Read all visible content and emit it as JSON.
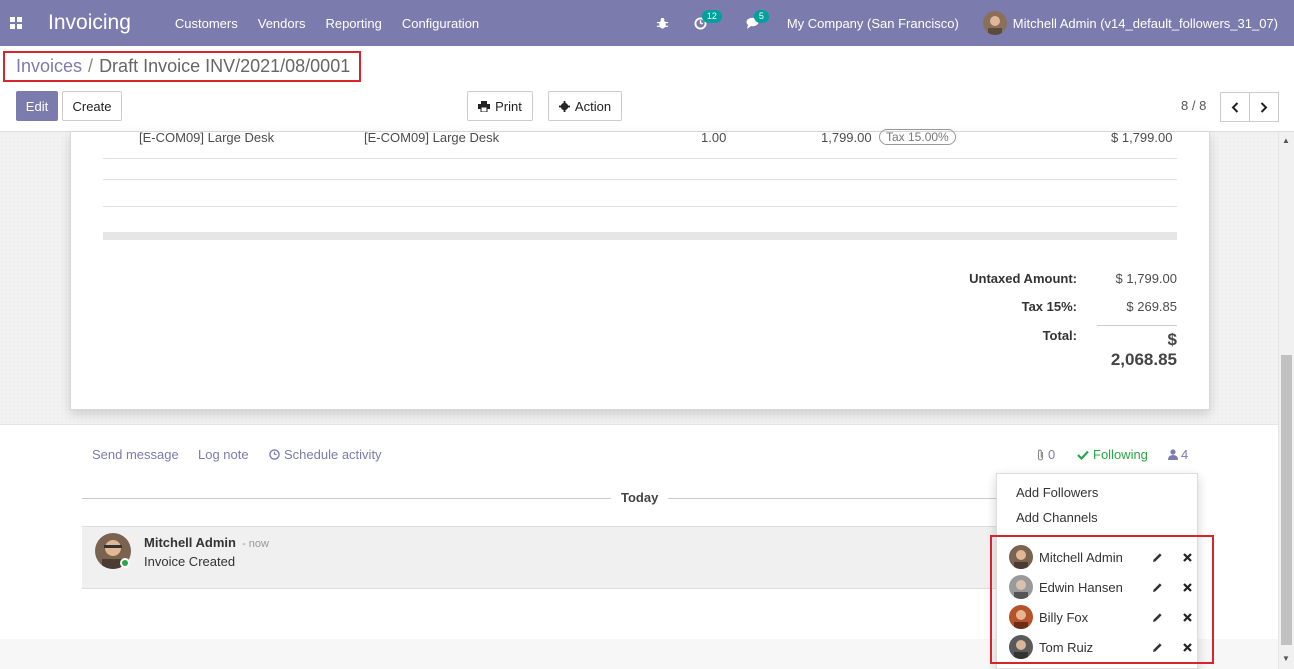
{
  "navbar": {
    "app_title": "Invoicing",
    "menu": [
      "Customers",
      "Vendors",
      "Reporting",
      "Configuration"
    ],
    "activity_count": "12",
    "message_count": "5",
    "company": "My Company (San Francisco)",
    "user": "Mitchell Admin (v14_default_followers_31_07)"
  },
  "breadcrumb": {
    "parent": "Invoices",
    "separator": "/",
    "current": "Draft Invoice INV/2021/08/0001"
  },
  "toolbar": {
    "edit_label": "Edit",
    "create_label": "Create",
    "print_label": "Print",
    "action_label": "Action"
  },
  "pager": {
    "value": "8 / 8"
  },
  "invoice_line": {
    "product": "[E-COM09] Large Desk",
    "label": "[E-COM09] Large Desk",
    "quantity": "1.00",
    "price": "1,799.00",
    "tax": "Tax 15.00%",
    "subtotal": "$ 1,799.00"
  },
  "totals": {
    "untaxed_label": "Untaxed Amount:",
    "untaxed_value": "$ 1,799.00",
    "tax_label": "Tax 15%:",
    "tax_value": "$ 269.85",
    "total_label": "Total:",
    "total_value": "$ 2,068.85"
  },
  "chatter": {
    "send_message": "Send message",
    "log_note": "Log note",
    "schedule_activity": "Schedule activity",
    "attachments_count": "0",
    "following": "Following",
    "followers_count": "4",
    "today_label": "Today",
    "message": {
      "author": "Mitchell Admin",
      "time": "- now",
      "body": "Invoice Created"
    }
  },
  "followers_menu": {
    "add_followers": "Add Followers",
    "add_channels": "Add Channels",
    "followers": [
      "Mitchell Admin",
      "Edwin Hansen",
      "Billy Fox",
      "Tom Ruiz"
    ]
  },
  "colors": {
    "brand": "#7c7bad",
    "accent": "#00a09d",
    "following": "#28a745",
    "highlight": "#d9242b"
  }
}
